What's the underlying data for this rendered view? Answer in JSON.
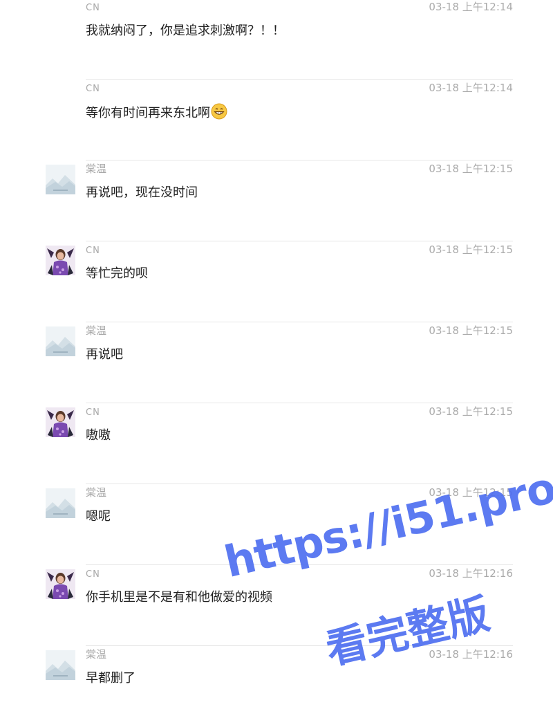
{
  "messages": [
    {
      "sender": "CN",
      "time": "03-18 上午12:14",
      "text": "我就纳闷了，你是追求刺激啊？！！",
      "avatar": "none"
    },
    {
      "sender": "CN",
      "time": "03-18 上午12:14",
      "text": "等你有时间再来东北啊",
      "avatar": "none",
      "emoji": "grinning-face-emoji"
    },
    {
      "sender": "棠温",
      "time": "03-18 上午12:15",
      "text": "再说吧，现在没时间",
      "avatar": "default"
    },
    {
      "sender": "CN",
      "time": "03-18 上午12:15",
      "text": "等忙完的呗",
      "avatar": "photo"
    },
    {
      "sender": "棠温",
      "time": "03-18 上午12:15",
      "text": "再说吧",
      "avatar": "default"
    },
    {
      "sender": "CN",
      "time": "03-18 上午12:15",
      "text": "嗷嗷",
      "avatar": "photo"
    },
    {
      "sender": "棠温",
      "time": "03-18 上午12:15",
      "text": "嗯呢",
      "avatar": "default"
    },
    {
      "sender": "CN",
      "time": "03-18 上午12:16",
      "text": "你手机里是不是有和他做爱的视频",
      "avatar": "photo"
    },
    {
      "sender": "棠温",
      "time": "03-18 上午12:16",
      "text": "早都删了",
      "avatar": "default"
    }
  ],
  "watermark": {
    "line1": "https://i51.pro",
    "line2": "看完整版"
  },
  "colors": {
    "name": "#a8a8a8",
    "time": "#aaaaaa",
    "text": "#222222",
    "divider": "#e6e6e6",
    "watermark": "#4f6ff0"
  }
}
